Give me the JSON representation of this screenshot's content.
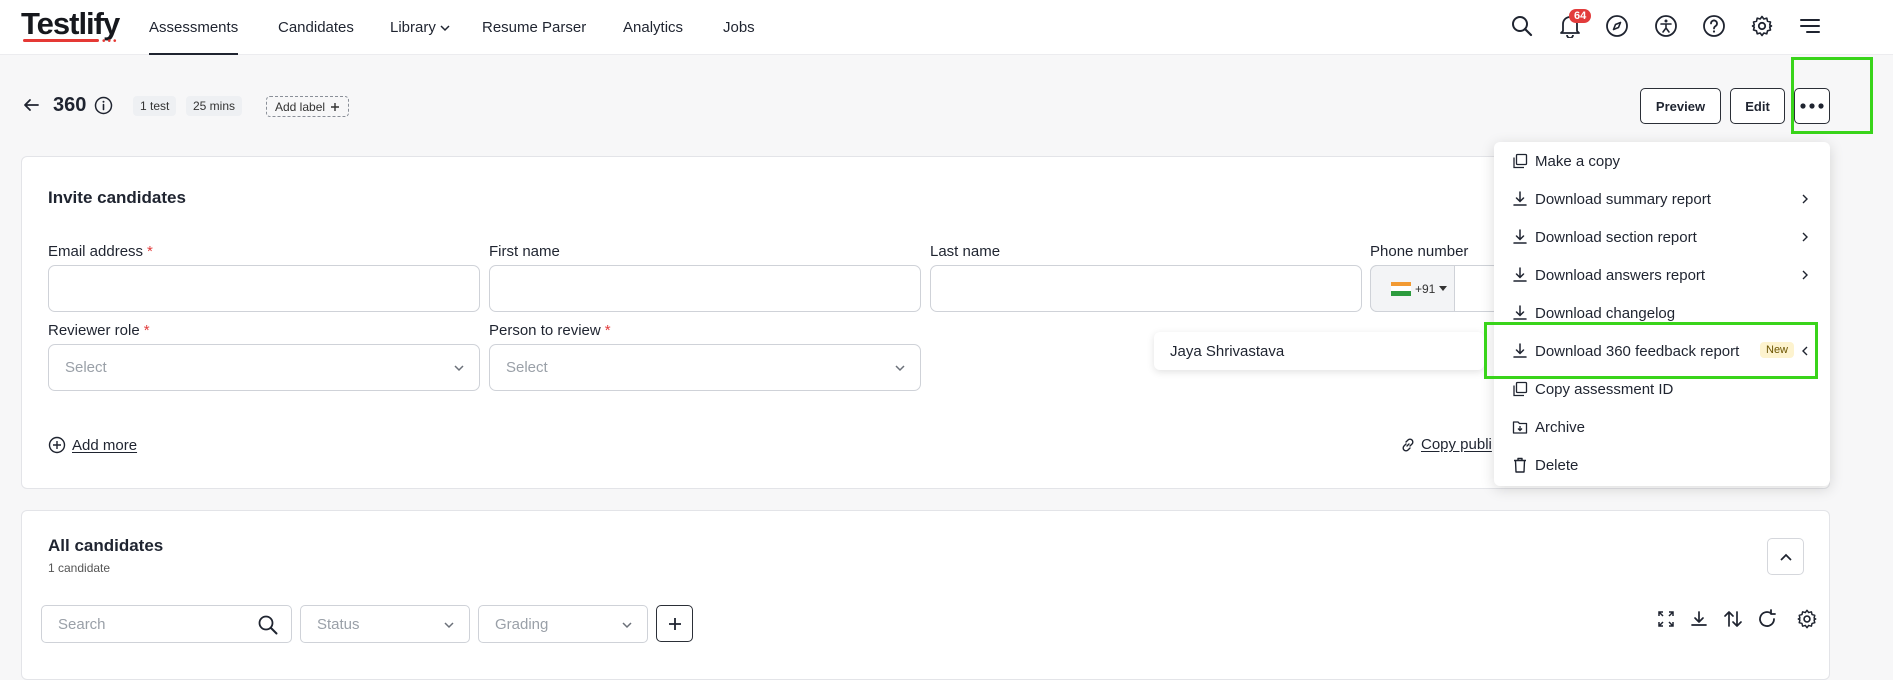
{
  "brand": {
    "name": "Testlify",
    "dots": "•••"
  },
  "nav": [
    {
      "id": "assessments",
      "label": "Assessments"
    },
    {
      "id": "candidates",
      "label": "Candidates"
    },
    {
      "id": "library",
      "label": "Library"
    },
    {
      "id": "resume_parser",
      "label": "Resume Parser"
    },
    {
      "id": "analytics",
      "label": "Analytics"
    },
    {
      "id": "jobs",
      "label": "Jobs"
    }
  ],
  "header_icons": [
    "search-icon",
    "bell-icon",
    "compass-icon",
    "accessibility-icon",
    "help-icon",
    "gear-icon",
    "menu-icon"
  ],
  "notifications": {
    "count": "64"
  },
  "assessment": {
    "title": "360",
    "tests": "1 test",
    "duration": "25 mins",
    "add_label": "Add label"
  },
  "actions": {
    "preview": "Preview",
    "edit": "Edit"
  },
  "invite": {
    "title": "Invite candidates",
    "email_label": "Email address",
    "first_name_label": "First name",
    "last_name_label": "Last name",
    "phone_label": "Phone number",
    "phone_prefix": "+91",
    "reviewer_role_label": "Reviewer role",
    "reviewer_role_value": "Select",
    "person_label": "Person to review",
    "person_value": "Select",
    "add_more": "Add more",
    "copy_public": "Copy publi"
  },
  "tooltip": {
    "text": "Jaya Shrivastava"
  },
  "menu": {
    "items": [
      {
        "label": "Make a copy",
        "icon": "copy-icon"
      },
      {
        "label": "Download summary report",
        "icon": "download-icon"
      },
      {
        "label": "Download section report",
        "icon": "download-icon"
      },
      {
        "label": "Download answers report",
        "icon": "download-icon"
      },
      {
        "label": "Download changelog",
        "icon": "download-icon"
      },
      {
        "label": "Download 360 feedback report",
        "icon": "download-icon",
        "badge": "New"
      },
      {
        "label": "Copy assessment ID",
        "icon": "copy-icon"
      },
      {
        "label": "Archive",
        "icon": "archive-icon"
      },
      {
        "label": "Delete",
        "icon": "trash-icon"
      }
    ]
  },
  "candidates": {
    "title": "All candidates",
    "count": "1 candidate",
    "search_placeholder": "Search",
    "status_placeholder": "Status",
    "grading_placeholder": "Grading"
  },
  "colors": {
    "highlight": "#39d41a",
    "badge": "#e23c3c",
    "new_badge": "#fdf3cf"
  }
}
